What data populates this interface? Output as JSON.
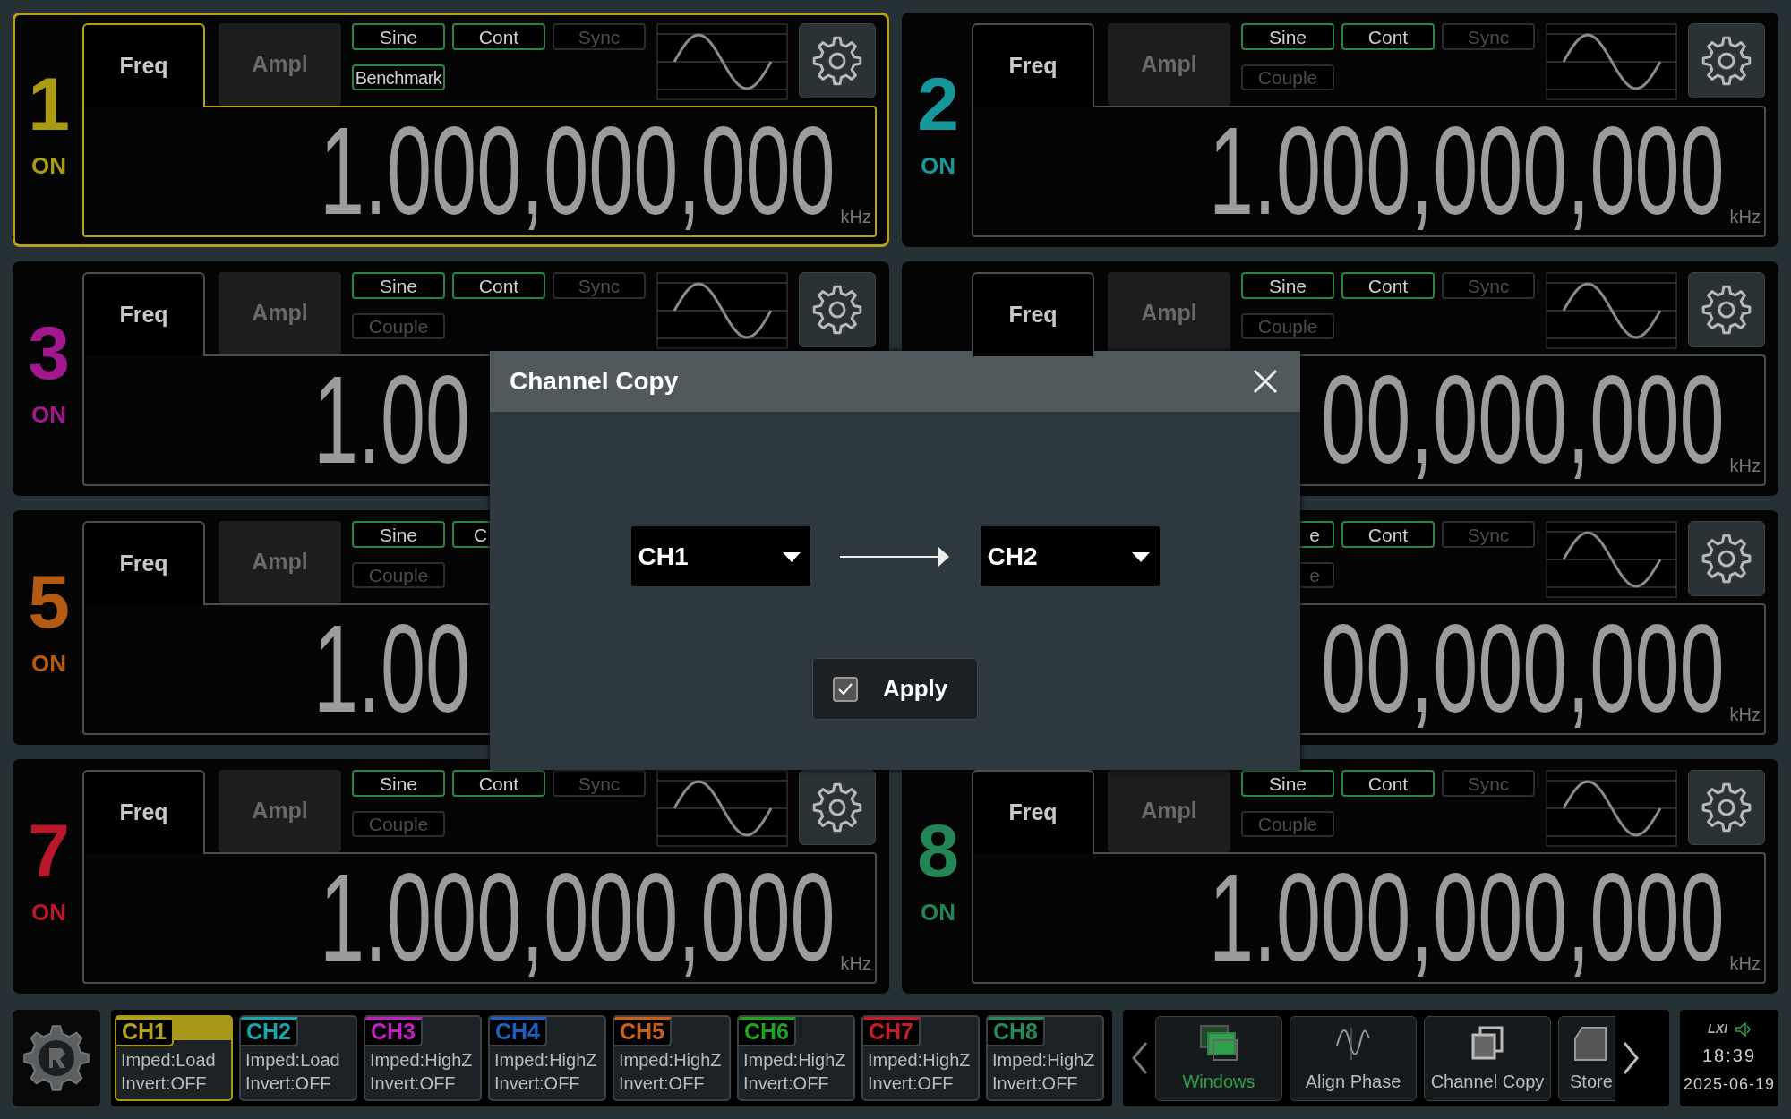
{
  "panels": [
    {
      "kind": "full",
      "number": "1",
      "status": "ON",
      "color": "#a99b14",
      "selected": true,
      "tabs": [
        {
          "label": "Freq",
          "selected": true
        },
        {
          "label": "Ampl",
          "selected": false
        }
      ],
      "button_rows": [
        [
          {
            "label": "Sine",
            "disabled": false,
            "kind": "full"
          },
          {
            "label": "Cont",
            "disabled": false,
            "kind": "full"
          },
          {
            "label": "Sync",
            "disabled": true,
            "kind": "full"
          }
        ],
        [
          {
            "label": "Benchmark",
            "disabled": false,
            "kind": "full"
          }
        ]
      ],
      "value": "1.000,000,000",
      "unit": "kHz"
    },
    {
      "kind": "full",
      "number": "2",
      "status": "ON",
      "color": "#15979c",
      "selected": false,
      "tabs": [
        {
          "label": "Freq",
          "selected": true
        },
        {
          "label": "Ampl",
          "selected": false
        }
      ],
      "button_rows": [
        [
          {
            "label": "Sine",
            "disabled": false,
            "kind": "full"
          },
          {
            "label": "Cont",
            "disabled": false,
            "kind": "full"
          },
          {
            "label": "Sync",
            "disabled": true,
            "kind": "full"
          }
        ],
        [
          {
            "label": "Couple",
            "disabled": true,
            "kind": "full"
          }
        ]
      ],
      "value": "1.000,000,000",
      "unit": "kHz"
    },
    {
      "kind": "cut_bottom_right",
      "number": "3",
      "status": "ON",
      "color": "#a3188f",
      "selected": false,
      "tabs": [
        {
          "label": "Freq",
          "selected": true
        },
        {
          "label": "Ampl",
          "selected": false
        }
      ],
      "button_rows": [
        [
          {
            "label": "Sine",
            "disabled": false,
            "kind": "full"
          },
          {
            "label": "Cont",
            "disabled": false,
            "kind": "full"
          },
          {
            "label": "Sync",
            "disabled": true,
            "kind": "full"
          }
        ],
        [
          {
            "label": "Couple",
            "disabled": true,
            "kind": "full"
          }
        ]
      ],
      "value": "1.00"
    },
    {
      "kind": "cut_bottom_left",
      "selected": false,
      "tabs": [
        {
          "label": "Freq",
          "selected": true
        },
        {
          "label": "Ampl",
          "selected": false
        }
      ],
      "button_rows": [
        [
          {
            "label": "Sine",
            "disabled": false,
            "kind": "full"
          },
          {
            "label": "Cont",
            "disabled": false,
            "kind": "full"
          },
          {
            "label": "Sync",
            "disabled": true,
            "kind": "full"
          }
        ],
        [
          {
            "label": "Couple",
            "disabled": true,
            "kind": "full"
          }
        ]
      ],
      "value": "00,000,000",
      "unit": "kHz"
    },
    {
      "kind": "cut_right",
      "number": "5",
      "status": "ON",
      "color": "#b55a14",
      "selected": false,
      "tabs": [
        {
          "label": "Freq",
          "selected": true
        },
        {
          "label": "Ampl",
          "selected": false
        }
      ],
      "button_rows": [
        [
          {
            "label": "Sine",
            "disabled": false,
            "kind": "full"
          },
          {
            "label": "C",
            "disabled": false,
            "kind": "cut_right"
          }
        ],
        [
          {
            "label": "Couple",
            "disabled": true,
            "kind": "full"
          }
        ]
      ],
      "value": "1.00"
    },
    {
      "kind": "cut_left",
      "selected": false,
      "button_rows": [
        [
          {
            "label": "e",
            "disabled": false,
            "kind": "cut_left"
          },
          {
            "label": "Cont",
            "disabled": false,
            "kind": "full"
          },
          {
            "label": "Sync",
            "disabled": true,
            "kind": "full"
          }
        ],
        [
          {
            "label": "e",
            "disabled": true,
            "kind": "cut_left"
          }
        ]
      ],
      "value": "00,000,000",
      "unit": "kHz"
    },
    {
      "kind": "full",
      "number": "7",
      "status": "ON",
      "color": "#b8182a",
      "selected": false,
      "tabs": [
        {
          "label": "Freq",
          "selected": true
        },
        {
          "label": "Ampl",
          "selected": false
        }
      ],
      "button_rows": [
        [
          {
            "label": "Sine",
            "disabled": false,
            "kind": "full"
          },
          {
            "label": "Cont",
            "disabled": false,
            "kind": "full"
          },
          {
            "label": "Sync",
            "disabled": true,
            "kind": "full"
          }
        ],
        [
          {
            "label": "Couple",
            "disabled": true,
            "kind": "full"
          }
        ]
      ],
      "value": "1.000,000,000",
      "unit": "kHz"
    },
    {
      "kind": "full",
      "number": "8",
      "status": "ON",
      "color": "#238454",
      "selected": false,
      "tabs": [
        {
          "label": "Freq",
          "selected": true
        },
        {
          "label": "Ampl",
          "selected": false
        }
      ],
      "button_rows": [
        [
          {
            "label": "Sine",
            "disabled": false,
            "kind": "full"
          },
          {
            "label": "Cont",
            "disabled": false,
            "kind": "full"
          },
          {
            "label": "Sync",
            "disabled": true,
            "kind": "full"
          }
        ],
        [
          {
            "label": "Couple",
            "disabled": true,
            "kind": "full"
          }
        ]
      ],
      "value": "1.000,000,000",
      "unit": "kHz"
    }
  ],
  "channel_strip": [
    {
      "label": "CH1",
      "color": "#b3a117",
      "impedance": "Imped:Load",
      "invert": "Invert:OFF",
      "selected": true
    },
    {
      "label": "CH2",
      "color": "#1aa3a8",
      "impedance": "Imped:Load",
      "invert": "Invert:OFF",
      "selected": false
    },
    {
      "label": "CH3",
      "color": "#c21fc2",
      "impedance": "Imped:HighZ",
      "invert": "Invert:OFF",
      "selected": false
    },
    {
      "label": "CH4",
      "color": "#1b5fc2",
      "impedance": "Imped:HighZ",
      "invert": "Invert:OFF",
      "selected": false
    },
    {
      "label": "CH5",
      "color": "#c8601a",
      "impedance": "Imped:HighZ",
      "invert": "Invert:OFF",
      "selected": false
    },
    {
      "label": "CH6",
      "color": "#1fa31f",
      "impedance": "Imped:HighZ",
      "invert": "Invert:OFF",
      "selected": false
    },
    {
      "label": "CH7",
      "color": "#c81a2a",
      "impedance": "Imped:HighZ",
      "invert": "Invert:OFF",
      "selected": false
    },
    {
      "label": "CH8",
      "color": "#1f8a5a",
      "impedance": "Imped:HighZ",
      "invert": "Invert:OFF",
      "selected": false
    }
  ],
  "functions": [
    {
      "label": "Windows",
      "kind": "windows",
      "selected": true
    },
    {
      "label": "Align Phase",
      "kind": "align",
      "selected": false
    },
    {
      "label": "Channel Copy",
      "kind": "copy",
      "selected": false
    },
    {
      "label": "Store",
      "kind": "store",
      "selected": false
    }
  ],
  "status": {
    "lxi": "LXI",
    "time": "18:39",
    "date": "2025-06-19"
  },
  "dialog": {
    "title": "Channel Copy",
    "source": "CH1",
    "target": "CH2",
    "apply": {
      "label": "Apply",
      "checked": true
    }
  }
}
